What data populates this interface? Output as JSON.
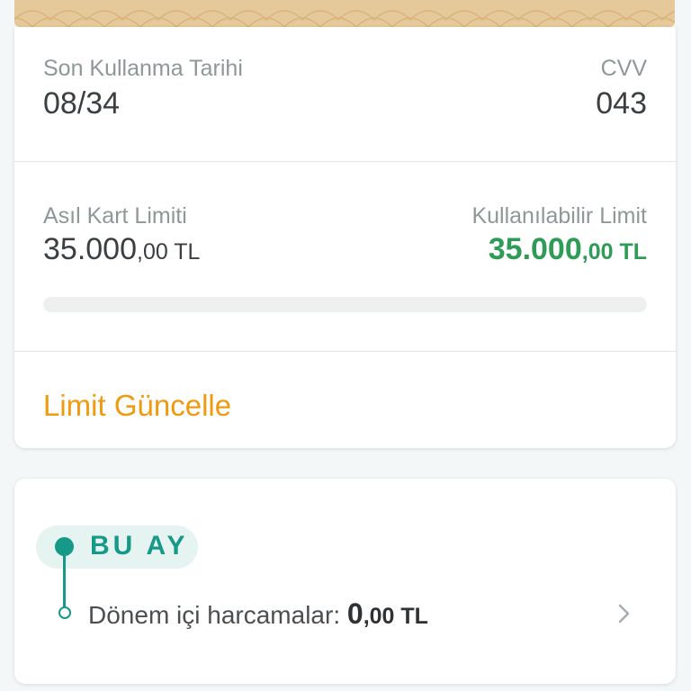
{
  "card": {
    "expiry_label": "Son Kullanma Tarihi",
    "expiry_value": "08/34",
    "cvv_label": "CVV",
    "cvv_value": "043",
    "main_limit_label": "Asıl Kart Limiti",
    "main_limit_int": "35.000",
    "main_limit_dec": ",00 TL",
    "available_limit_label": "Kullanılabilir Limit",
    "available_limit_int": "35.000",
    "available_limit_dec": ",00 TL",
    "limit_used_fraction": 0.0,
    "update_limit_label": "Limit Güncelle"
  },
  "month": {
    "title": "BU AY",
    "spending_label": "Dönem içi harcamalar:",
    "spending_int": "0",
    "spending_dec": ",00 TL"
  },
  "colors": {
    "accent_green": "#2e9c57",
    "accent_teal": "#17998a",
    "link_orange": "#ef9a0f",
    "card_gold": "#e6c99a"
  },
  "icons": {
    "chevron": "chevron-right-icon"
  }
}
